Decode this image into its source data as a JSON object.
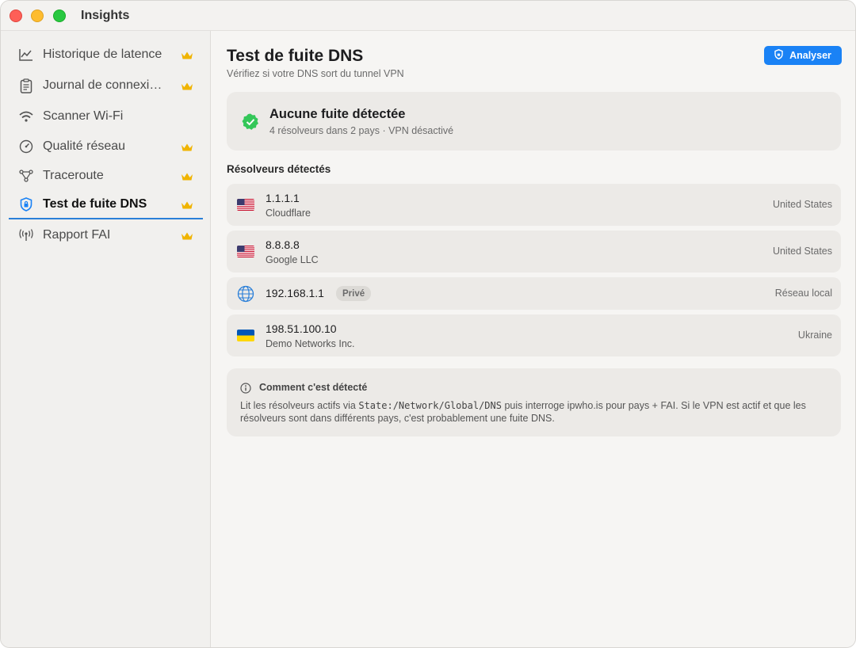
{
  "app": {
    "title": "Insights"
  },
  "sidebar": {
    "items": [
      {
        "label": "Historique de latence",
        "icon": "chart-line-icon",
        "premium": true,
        "active": false
      },
      {
        "label": "Journal de connexi…",
        "icon": "clipboard-icon",
        "premium": true,
        "active": false
      },
      {
        "label": "Scanner Wi-Fi",
        "icon": "wifi-icon",
        "premium": false,
        "active": false
      },
      {
        "label": "Qualité réseau",
        "icon": "gauge-icon",
        "premium": true,
        "active": false
      },
      {
        "label": "Traceroute",
        "icon": "network-nodes-icon",
        "premium": true,
        "active": false
      },
      {
        "label": "Test de fuite DNS",
        "icon": "shield-lock-icon",
        "premium": true,
        "active": true
      },
      {
        "label": "Rapport FAI",
        "icon": "antenna-icon",
        "premium": true,
        "active": false
      }
    ]
  },
  "main": {
    "title": "Test de fuite DNS",
    "subtitle": "Vérifiez si votre DNS sort du tunnel VPN",
    "analyse_label": "Analyser",
    "status": {
      "title": "Aucune fuite détectée",
      "subtitle": "4 résolveurs dans 2 pays · VPN désactivé",
      "color": "#34c759"
    },
    "resolvers_title": "Résolveurs détectés",
    "resolvers": [
      {
        "ip": "1.1.1.1",
        "org": "Cloudflare",
        "country": "United States",
        "flag": "us-flag-icon"
      },
      {
        "ip": "8.8.8.8",
        "org": "Google LLC",
        "country": "United States",
        "flag": "us-flag-icon"
      },
      {
        "ip": "192.168.1.1",
        "org": "",
        "badge": "Privé",
        "country": "Réseau local",
        "flag": "globe-icon"
      },
      {
        "ip": "198.51.100.10",
        "org": "Demo Networks Inc.",
        "country": "Ukraine",
        "flag": "ua-flag-icon"
      }
    ],
    "info": {
      "title": "Comment c'est détecté",
      "text_before": "Lit les résolveurs actifs via ",
      "code": "State:/Network/Global/DNS",
      "text_after": " puis interroge ipwho.is pour pays + FAI. Si le VPN est actif et que les résolveurs sont dans différents pays, c'est probablement une fuite DNS."
    }
  },
  "colors": {
    "accent": "#1a82f5",
    "crown": "#f0b400",
    "selection": "#2a7fd8"
  }
}
